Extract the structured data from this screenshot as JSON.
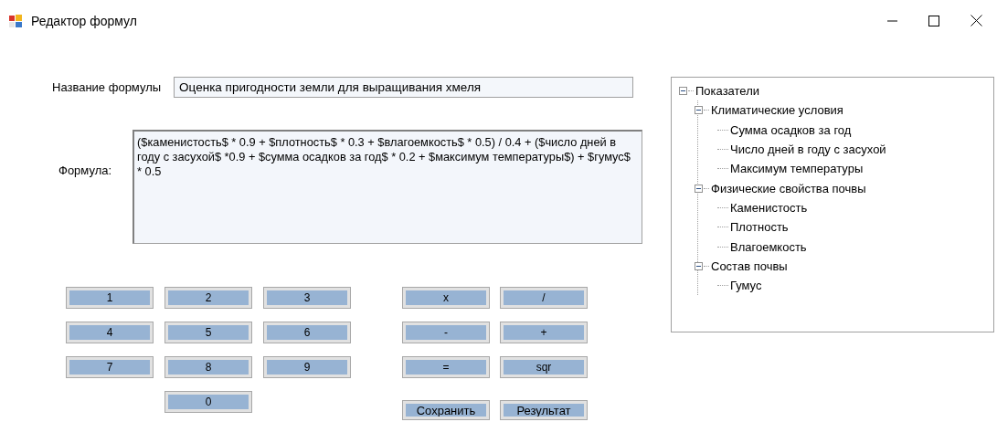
{
  "window": {
    "title": "Редактор формул"
  },
  "name_label": "Название формулы",
  "name_value": "Оценка пригодности земли для выращивания хмеля",
  "formula_label": "Формула:",
  "formula_value": "($каменистость$ * 0.9 + $плотность$ * 0.3 + $влагоемкость$ * 0.5) / 0.4 + ($число дней в году с засухой$ *0.9 + $сумма осадков за год$ * 0.2 + $максимум температуры$) + $гумус$ * 0.5",
  "digit_rows": [
    [
      "1",
      "2",
      "3"
    ],
    [
      "4",
      "5",
      "6"
    ],
    [
      "7",
      "8",
      "9"
    ],
    [
      "0"
    ]
  ],
  "operator_rows": [
    [
      "x",
      "/"
    ],
    [
      "-",
      "+"
    ],
    [
      "=",
      "sqr"
    ]
  ],
  "actions": [
    "Сохранить",
    "Результат"
  ],
  "tree": [
    {
      "label": "Показатели",
      "expanded": true,
      "children": [
        {
          "label": "Климатические условия",
          "expanded": true,
          "children": [
            {
              "label": "Сумма осадков за год"
            },
            {
              "label": "Число дней в году с засухой"
            },
            {
              "label": "Максимум температуры"
            }
          ]
        },
        {
          "label": "Физические свойства почвы",
          "expanded": true,
          "children": [
            {
              "label": "Каменистость"
            },
            {
              "label": "Плотность"
            },
            {
              "label": "Влагоемкость"
            }
          ]
        },
        {
          "label": "Состав почвы",
          "expanded": true,
          "children": [
            {
              "label": "Гумус"
            }
          ]
        }
      ]
    }
  ]
}
